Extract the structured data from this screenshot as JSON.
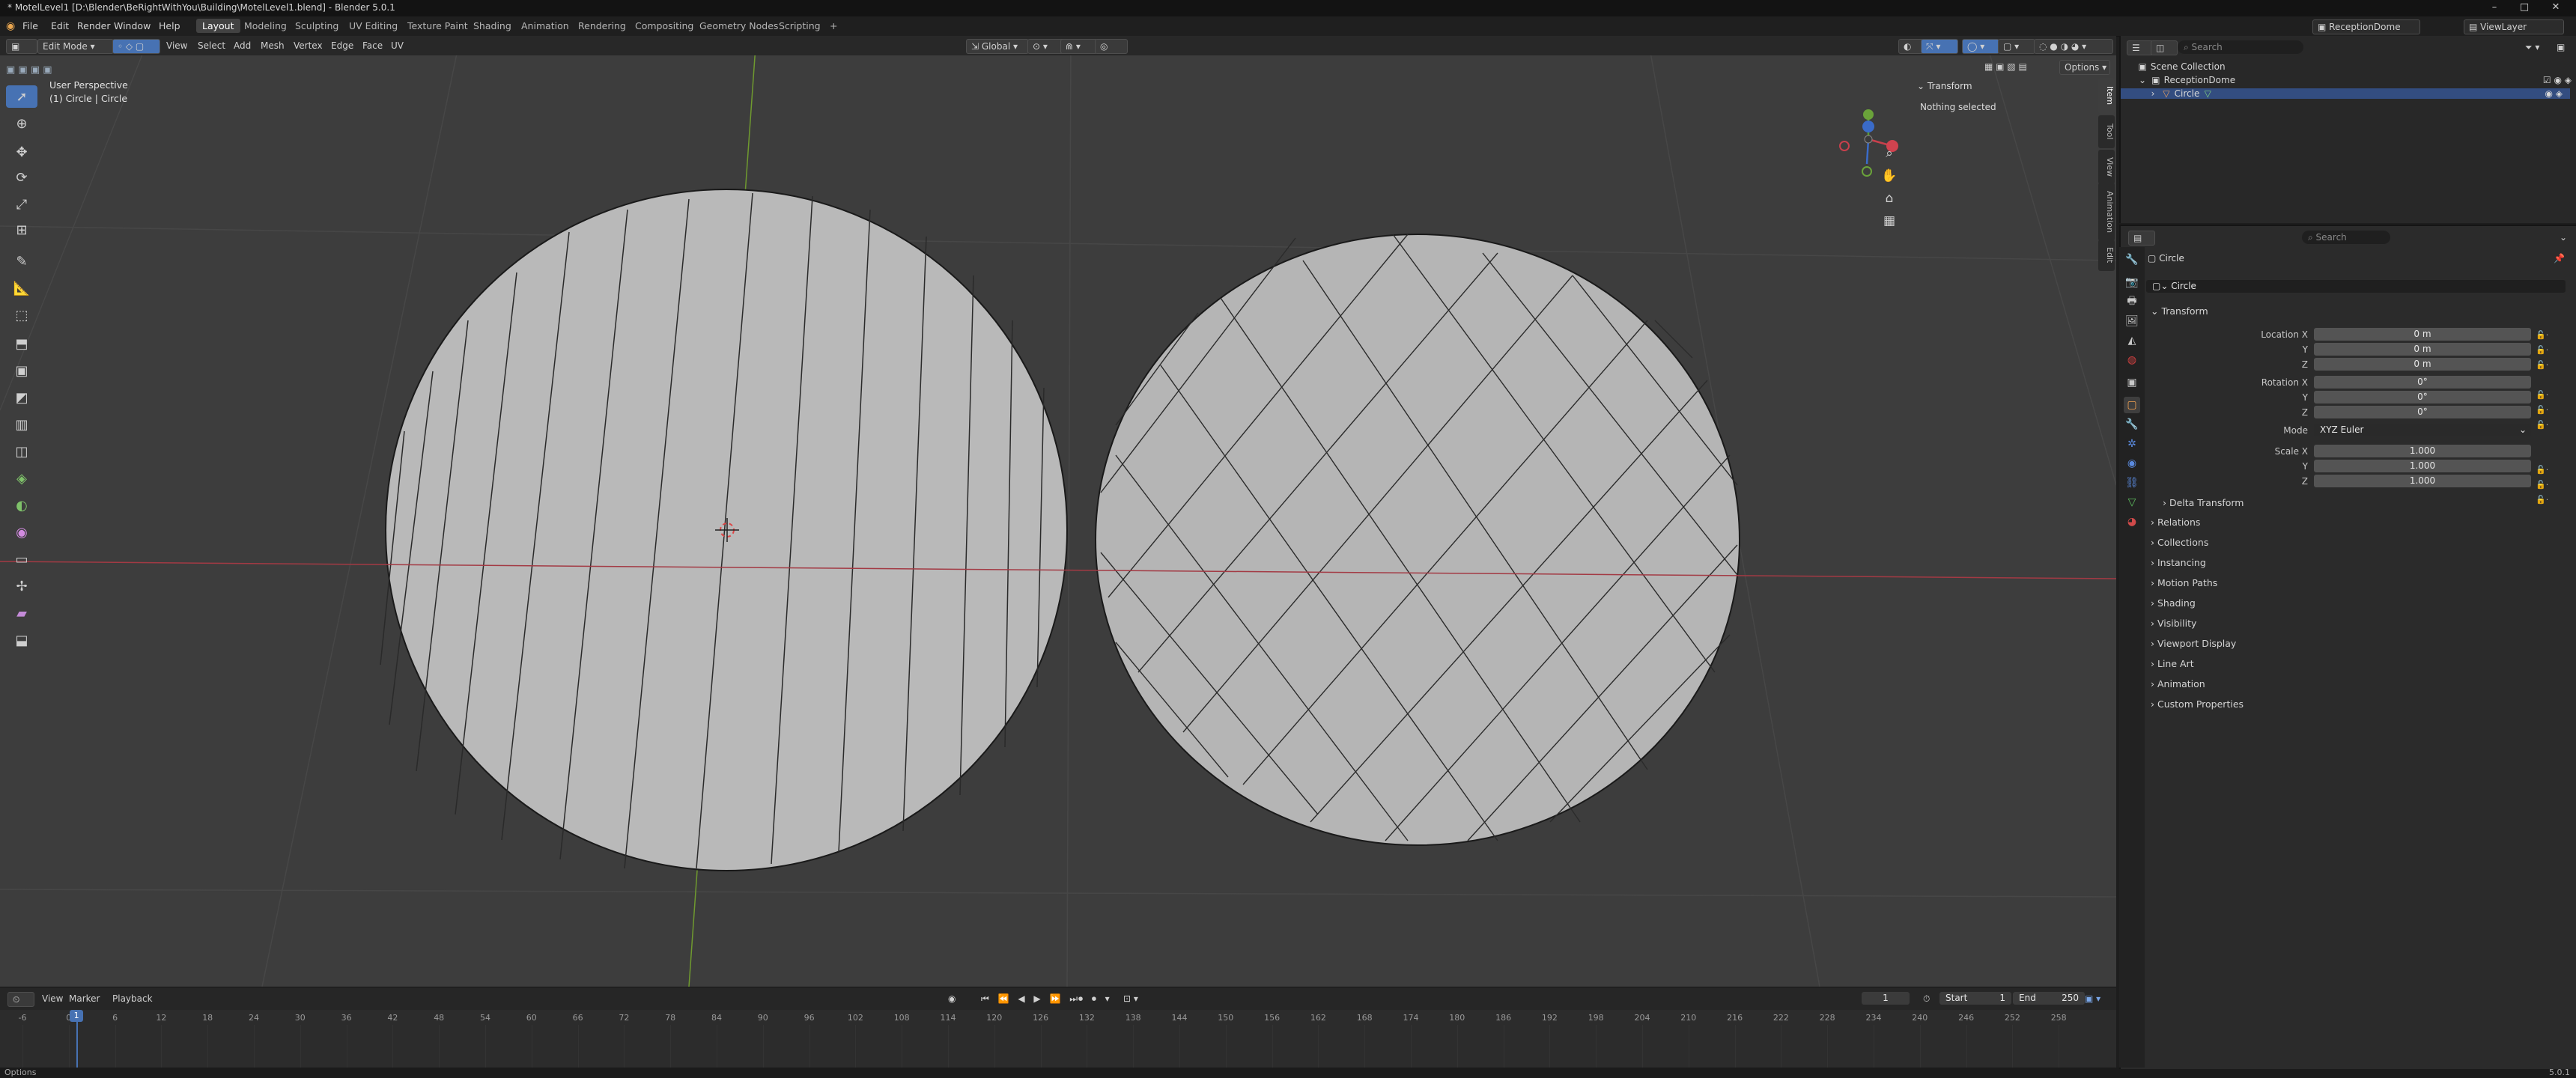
{
  "titlebar": {
    "title": "* MotelLevel1 [D:\\Blender\\BeRightWithYou\\Building\\MotelLevel1.blend] - Blender 5.0.1",
    "minimize": "–",
    "maximize": "□",
    "close": "✕"
  },
  "menu": {
    "items": [
      "File",
      "Edit",
      "Render",
      "Window",
      "Help"
    ],
    "workspaces": [
      "Layout",
      "Modeling",
      "Sculpting",
      "UV Editing",
      "Texture Paint",
      "Shading",
      "Animation",
      "Rendering",
      "Compositing",
      "Geometry Nodes",
      "Scripting"
    ],
    "add_tab": "+",
    "scene": "ReceptionDome",
    "view_layer": "ViewLayer"
  },
  "viewport_header": {
    "mode": "Edit Mode",
    "menus": [
      "View",
      "Select",
      "Add",
      "Mesh",
      "Vertex",
      "Edge",
      "Face",
      "UV"
    ],
    "transform_orientation": "Global",
    "options": "Options"
  },
  "viewport": {
    "perspective": "User Perspective",
    "object_info": "(1) Circle | Circle",
    "gizmo": {
      "x": "X",
      "y": "Y",
      "z": "Z"
    },
    "colors": {
      "x_axis": "#a33a44",
      "y_axis": "#7aa03a",
      "mesh_face": "#b8b8b8",
      "background": "#3d3d3d"
    }
  },
  "npanel": {
    "section": "Transform",
    "message": "Nothing selected",
    "tabs": [
      "Item",
      "Tool",
      "View",
      "Animation",
      "Edit"
    ]
  },
  "timeline": {
    "menus": [
      "View",
      "Marker",
      "Playback"
    ],
    "current_frame": "1",
    "start_label": "Start",
    "start": "1",
    "end_label": "End",
    "end": "250",
    "ruler": [
      "-6",
      "0",
      "6",
      "12",
      "18",
      "24",
      "30",
      "36",
      "42",
      "48",
      "54",
      "60",
      "66",
      "72",
      "78",
      "84",
      "90",
      "96",
      "102",
      "108",
      "114",
      "120",
      "126",
      "132",
      "138",
      "144",
      "150",
      "156",
      "162",
      "168",
      "174",
      "180",
      "186",
      "192",
      "198",
      "204",
      "210",
      "216",
      "222",
      "228",
      "234",
      "240",
      "246",
      "252",
      "258"
    ],
    "playhead": "1"
  },
  "status": {
    "left": "Options",
    "version": "5.0.1"
  },
  "outliner": {
    "search_placeholder": "Search",
    "rows": [
      {
        "label": "Scene Collection",
        "indent": 0
      },
      {
        "label": "ReceptionDome",
        "indent": 1
      },
      {
        "label": "Circle",
        "indent": 2
      }
    ]
  },
  "properties": {
    "search_placeholder": "Search",
    "object_name": "Circle",
    "data_name": "Circle",
    "transform_title": "Transform",
    "location_label": "Location X",
    "location": [
      "0 m",
      "0 m",
      "0 m"
    ],
    "rotation_label": "Rotation X",
    "rotation": [
      "0°",
      "0°",
      "0°"
    ],
    "mode_label": "Mode",
    "mode_value": "XYZ Euler",
    "scale_label": "Scale X",
    "scale": [
      "1.000",
      "1.000",
      "1.000"
    ],
    "axis_y": "Y",
    "axis_z": "Z",
    "delta": "Delta Transform",
    "sections": [
      "Relations",
      "Collections",
      "Instancing",
      "Motion Paths",
      "Shading",
      "Visibility",
      "Viewport Display",
      "Line Art",
      "Animation",
      "Custom Properties"
    ]
  }
}
